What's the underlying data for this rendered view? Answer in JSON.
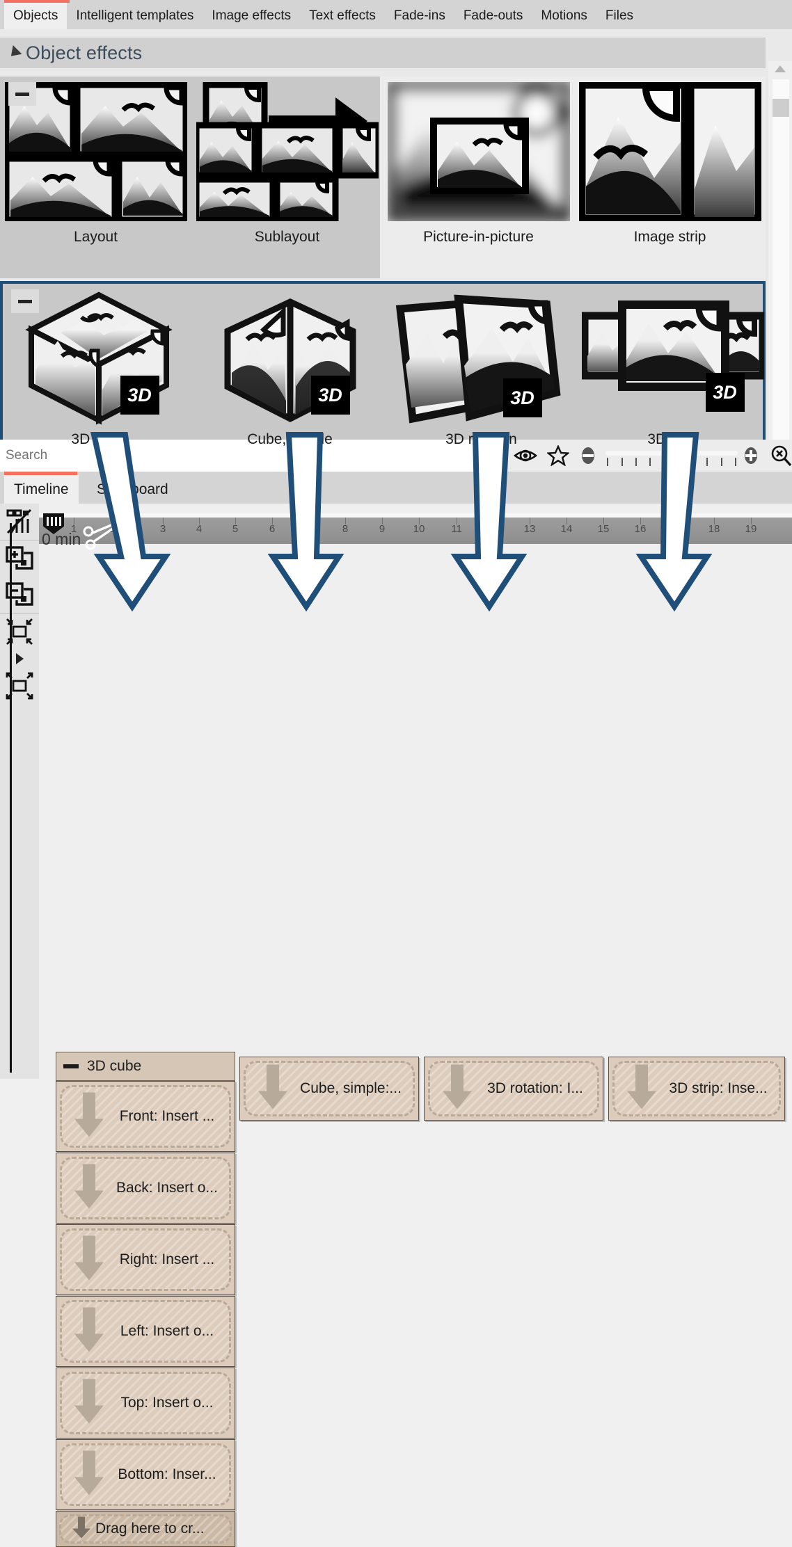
{
  "tabs": [
    {
      "label": "Objects",
      "active": true
    },
    {
      "label": "Intelligent templates",
      "active": false
    },
    {
      "label": "Image effects",
      "active": false
    },
    {
      "label": "Text effects",
      "active": false
    },
    {
      "label": "Fade-ins",
      "active": false
    },
    {
      "label": "Fade-outs",
      "active": false
    },
    {
      "label": "Motions",
      "active": false
    },
    {
      "label": "Files",
      "active": false
    }
  ],
  "panel": {
    "title": "Object effects",
    "collapse_icon": "minus-icon",
    "expander_icon": "triangle-collapse-icon"
  },
  "effects_row1": [
    {
      "label": "Layout",
      "icon": "layout-grid-thumbnail",
      "badge": ""
    },
    {
      "label": "Sublayout",
      "icon": "sublayout-thumbnail",
      "badge": ""
    },
    {
      "label": "Picture-in-picture",
      "icon": "picture-in-picture-thumbnail",
      "badge": ""
    },
    {
      "label": "Image strip",
      "icon": "image-strip-thumbnail",
      "badge": ""
    }
  ],
  "effects_row2": [
    {
      "label": "3D cube",
      "icon": "3d-cube-thumbnail",
      "badge": "3D"
    },
    {
      "label": "Cube, simple",
      "icon": "cube-simple-thumbnail",
      "badge": "3D"
    },
    {
      "label": "3D rotation",
      "icon": "3d-rotation-thumbnail",
      "badge": "3D"
    },
    {
      "label": "3D strip",
      "icon": "3d-strip-thumbnail",
      "badge": "3D"
    }
  ],
  "search": {
    "placeholder": "Search",
    "value": "",
    "icons": [
      "chevron-left-icon",
      "eye-icon",
      "star-icon",
      "minus-icon",
      "plus-icon",
      "magnifier-reset-icon"
    ]
  },
  "timeline_tabs": [
    {
      "label": "Timeline",
      "active": true
    },
    {
      "label": "Storyboard",
      "active": false
    }
  ],
  "left_tools": [
    {
      "name": "toggle-waveform-icon"
    },
    {
      "name": "add-track-icon"
    },
    {
      "name": "remove-track-icon"
    },
    {
      "name": "shrink-track-icon"
    },
    {
      "name": "expand-track-icon"
    }
  ],
  "ruler": {
    "zero_label": "0 min",
    "ticks": [
      "1",
      "2",
      "3",
      "4",
      "5",
      "6",
      "7",
      "8",
      "9",
      "10",
      "11",
      "12",
      "13",
      "14",
      "15",
      "16",
      "17",
      "18",
      "19"
    ]
  },
  "track": {
    "header_label": "3D cube",
    "collapse_icon": "minus-icon"
  },
  "clips_main_track": [
    {
      "label": "Front: Insert ...",
      "icon": "down-arrow-icon"
    },
    {
      "label": "Back: Insert o...",
      "icon": "down-arrow-icon"
    },
    {
      "label": "Right: Insert ...",
      "icon": "down-arrow-icon"
    },
    {
      "label": "Left: Insert o...",
      "icon": "down-arrow-icon"
    },
    {
      "label": "Top: Insert o...",
      "icon": "down-arrow-icon"
    },
    {
      "label": "Bottom: Inser...",
      "icon": "down-arrow-icon"
    },
    {
      "label": "Drag here to cr...",
      "icon": "down-arrow-icon",
      "drag_target": true
    }
  ],
  "clips_top_row": [
    {
      "label": "Cube, simple:...",
      "icon": "down-arrow-icon"
    },
    {
      "label": "3D rotation: I...",
      "icon": "down-arrow-icon"
    },
    {
      "label": "3D strip: Inse...",
      "icon": "down-arrow-icon"
    }
  ],
  "colors": {
    "accent_red": "#f4705f",
    "highlight_blue": "#1f4e79",
    "clip_tan": "#ddccbb",
    "panel_gray": "#d0d0d0",
    "title_blue": "#3c4c5c"
  }
}
